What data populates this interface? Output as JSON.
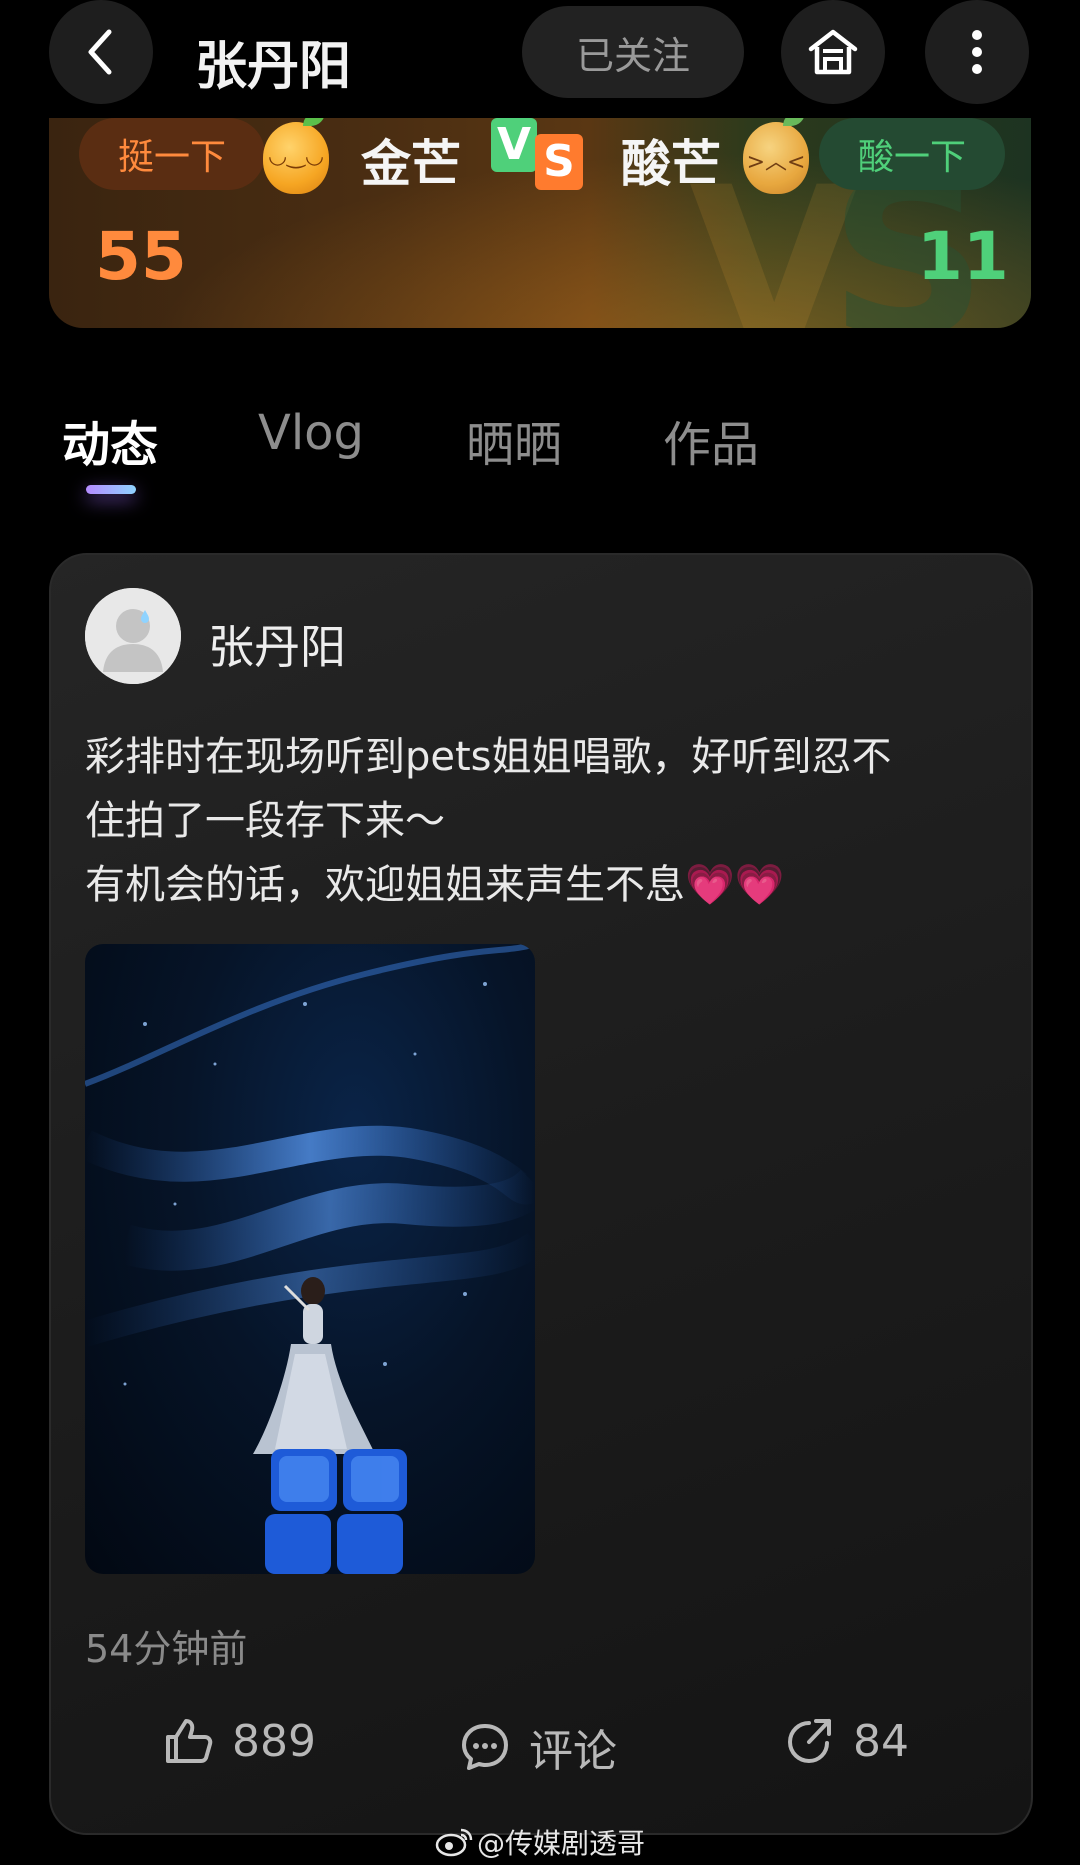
{
  "header": {
    "back_icon": "chevron-left-icon",
    "title": "张丹阳",
    "follow_label": "已关注",
    "home_icon": "home-icon",
    "more_icon": "more-vertical-icon"
  },
  "versus": {
    "left_button": "挺一下",
    "left_team": "金芒",
    "left_score": "55",
    "vs_v": "V",
    "vs_s": "S",
    "right_team": "酸芒",
    "right_button": "酸一下",
    "right_score": "11",
    "colors": {
      "left_accent": "#ff8a3d",
      "right_accent": "#4fd07a"
    }
  },
  "tabs": [
    {
      "label": "动态",
      "active": true
    },
    {
      "label": "Vlog",
      "active": false
    },
    {
      "label": "晒晒",
      "active": false
    },
    {
      "label": "作品",
      "active": false
    }
  ],
  "post": {
    "author": "张丹阳",
    "text_line1": "彩排时在现场听到pets姐姐唱歌，好听到忍不",
    "text_line2": "住拍了一段存下来～",
    "text_line3": "有机会的话，欢迎姐姐来声生不息",
    "emoji": "💗💗",
    "time": "54分钟前",
    "like_count": "889",
    "comment_label": "评论",
    "share_count": "84"
  },
  "watermark": "@传媒剧透哥"
}
